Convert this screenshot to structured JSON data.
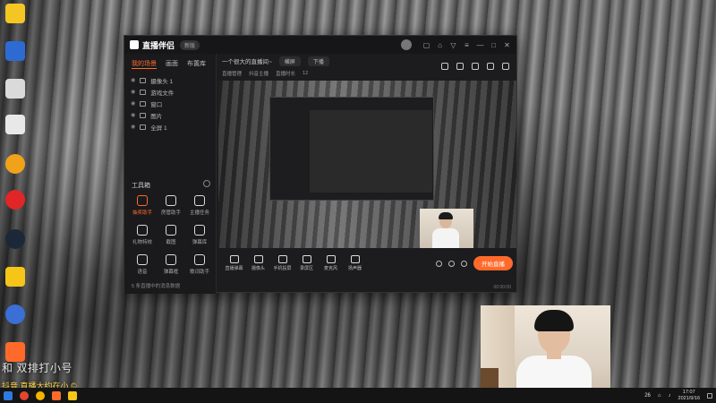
{
  "app": {
    "name": "直播伴侣",
    "badge": "新版",
    "stream_title": "一个很大的直播间~",
    "title_pill_1": "横屏",
    "title_pill_2": "下播",
    "meta_text_1": "直播管理",
    "meta_text_2": "抖音主播",
    "meta_text_3": "直播时长",
    "meta_counter": "12",
    "sidebar_tabs": [
      "我的场景",
      "画面",
      "布置库"
    ],
    "sources": [
      "摄像头 1",
      "游戏文件",
      "窗口",
      "图片",
      "全屏 1"
    ],
    "tools_title": "工具箱",
    "tools": [
      {
        "label": "抽奖助手",
        "hot": true
      },
      {
        "label": "房管助手",
        "hot": false
      },
      {
        "label": "主播任务",
        "hot": false
      },
      {
        "label": "礼物特效",
        "hot": false
      },
      {
        "label": "截图",
        "hot": false
      },
      {
        "label": "弹幕库",
        "hot": false
      },
      {
        "label": "语音",
        "hot": false
      },
      {
        "label": "弹幕框",
        "hot": false
      },
      {
        "label": "歌词助手",
        "hot": false
      }
    ],
    "side_footer": "5 条直播中的消息数据",
    "controls": [
      "直播弹幕",
      "摄像头",
      "手机投屏",
      "录屏区",
      "麦克风",
      "扬声器"
    ],
    "live_button": "开始直播",
    "status_time": "00:00:00"
  },
  "overlay": {
    "title": "和 双排打小号",
    "sub": "抖音 直播大约在小 ©"
  },
  "taskbar": {
    "lang": "26",
    "time": "17:07",
    "date": "2021/9/16"
  }
}
